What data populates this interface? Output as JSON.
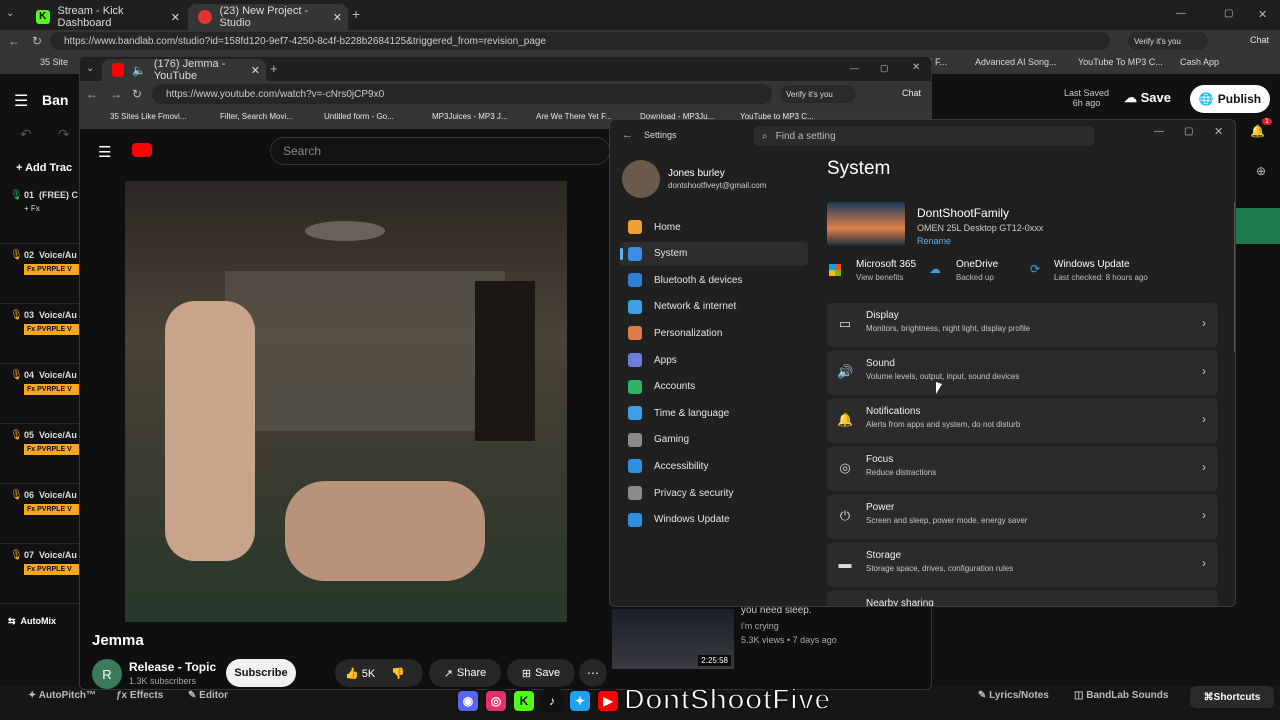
{
  "browser_back": {
    "tabs": [
      {
        "title": "Stream - Kick Dashboard"
      },
      {
        "title": "(23) New Project - Studio"
      }
    ],
    "url": "https://www.bandlab.com/studio?id=158fd120-9ef7-4250-8c4f-b228b2684125&triggered_from=revision_page",
    "verify_label": "Verify it's you",
    "chat_label": "Chat",
    "bookmarks": [
      {
        "label": "35 Site"
      },
      {
        "label": "I F..."
      },
      {
        "label": "Advanced AI Song..."
      },
      {
        "label": "YouTube To MP3 C..."
      },
      {
        "label": "Cash App"
      }
    ]
  },
  "bandlab": {
    "logo": "Ban",
    "last_saved_label": "Last Saved",
    "last_saved_time": "6h ago",
    "save_label": "Save",
    "publish_label": "Publish",
    "add_track_label": "Add Trac",
    "notif_count": "1",
    "tracks": [
      {
        "num": "01",
        "name": "(FREE) C",
        "fx": "+ Fx"
      },
      {
        "num": "02",
        "name": "Voice/Au",
        "fx": "Fx PVRPLE V"
      },
      {
        "num": "03",
        "name": "Voice/Au",
        "fx": "Fx PVRPLE V"
      },
      {
        "num": "04",
        "name": "Voice/Au",
        "fx": "Fx PVRPLE V"
      },
      {
        "num": "05",
        "name": "Voice/Au",
        "fx": "Fx PVRPLE V"
      },
      {
        "num": "06",
        "name": "Voice/Au",
        "fx": "Fx PVRPLE V"
      },
      {
        "num": "07",
        "name": "Voice/Au",
        "fx": "Fx PVRPLE V"
      }
    ],
    "automix_label": "AutoMix",
    "bottom": {
      "autopitch": "AutoPitch™",
      "effects": "Effects",
      "editor": "Editor",
      "lyrics": "Lyrics/Notes",
      "sounds": "BandLab Sounds",
      "shortcuts": "Shortcuts"
    }
  },
  "youtube_window": {
    "tab_title": "(176) Jemma - YouTube",
    "url": "https://www.youtube.com/watch?v=-cNrs0jCP9x0",
    "verify_label": "Verify it's you",
    "chat_label": "Chat",
    "bookmarks": [
      {
        "label": "35 Sites Like Fmovi..."
      },
      {
        "label": "Filter, Search Movi..."
      },
      {
        "label": "Untitled form - Go..."
      },
      {
        "label": "MP3Juices - MP3 J..."
      },
      {
        "label": "Are We There Yet F..."
      },
      {
        "label": "Download - MP3Ju..."
      },
      {
        "label": "YouTube to MP3 C..."
      }
    ],
    "search_placeholder": "Search",
    "video_title": "Jemma",
    "channel_initial": "R",
    "channel_name": "Release - Topic",
    "subscribers": "1.3K subscribers",
    "subscribe_label": "Subscribe",
    "likes": "5K",
    "share_label": "Share",
    "save_label": "Save",
    "rec": {
      "title": "you need sleep.",
      "channel": "i'm crying",
      "meta": "5.3K views • 7 days ago",
      "duration": "2:25:58"
    }
  },
  "settings": {
    "title": "Settings",
    "search_placeholder": "Find a setting",
    "user_name": "Jones burley",
    "user_email": "dontshootfiveyt@gmail.com",
    "nav": [
      {
        "label": "Home",
        "color": "#f0a030"
      },
      {
        "label": "System",
        "color": "#3a8ee6"
      },
      {
        "label": "Bluetooth & devices",
        "color": "#2f7fd8"
      },
      {
        "label": "Network & internet",
        "color": "#3aa0e8"
      },
      {
        "label": "Personalization",
        "color": "#e07a4a"
      },
      {
        "label": "Apps",
        "color": "#6a7fd8"
      },
      {
        "label": "Accounts",
        "color": "#2fb36a"
      },
      {
        "label": "Time & language",
        "color": "#3a9ee8"
      },
      {
        "label": "Gaming",
        "color": "#8a8a8a"
      },
      {
        "label": "Accessibility",
        "color": "#2f8fe0"
      },
      {
        "label": "Privacy & security",
        "color": "#8a8a8a"
      },
      {
        "label": "Windows Update",
        "color": "#2f8fe0"
      }
    ],
    "page_title": "System",
    "device_name": "DontShootFamily",
    "device_model": "OMEN 25L Desktop GT12-0xxx",
    "rename_label": "Rename",
    "status": [
      {
        "title": "Microsoft 365",
        "sub": "View benefits"
      },
      {
        "title": "OneDrive",
        "sub": "Backed up"
      },
      {
        "title": "Windows Update",
        "sub": "Last checked: 8 hours ago"
      }
    ],
    "items": [
      {
        "title": "Display",
        "sub": "Monitors, brightness, night light, display profile",
        "icon": "▭"
      },
      {
        "title": "Sound",
        "sub": "Volume levels, output, input, sound devices",
        "icon": "🔊"
      },
      {
        "title": "Notifications",
        "sub": "Alerts from apps and system, do not disturb",
        "icon": "🔔"
      },
      {
        "title": "Focus",
        "sub": "Reduce distractions",
        "icon": "◎"
      },
      {
        "title": "Power",
        "sub": "Screen and sleep, power mode, energy saver",
        "icon": "⏻"
      },
      {
        "title": "Storage",
        "sub": "Storage space, drives, configuration rules",
        "icon": "▬"
      },
      {
        "title": "Nearby sharing",
        "sub": "",
        "icon": ""
      }
    ]
  },
  "overlay": {
    "handle": "DontShootFive"
  }
}
